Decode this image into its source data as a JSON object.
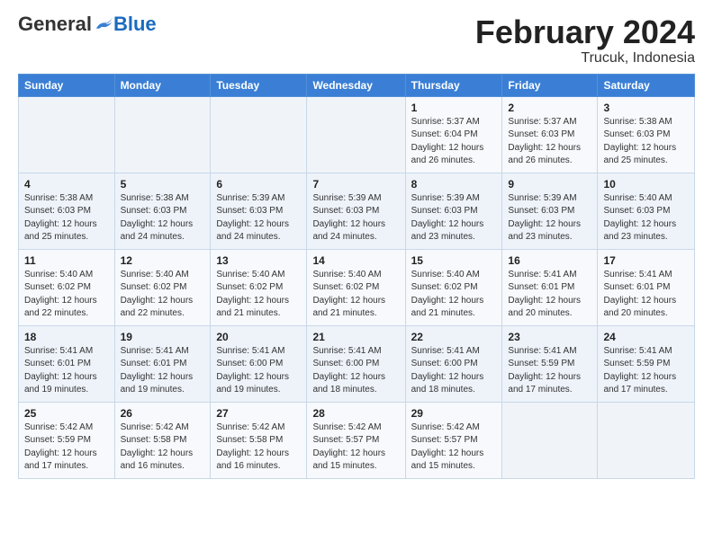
{
  "header": {
    "logo_general": "General",
    "logo_blue": "Blue",
    "month_title": "February 2024",
    "location": "Trucuk, Indonesia"
  },
  "weekdays": [
    "Sunday",
    "Monday",
    "Tuesday",
    "Wednesday",
    "Thursday",
    "Friday",
    "Saturday"
  ],
  "weeks": [
    [
      {
        "day": "",
        "info": ""
      },
      {
        "day": "",
        "info": ""
      },
      {
        "day": "",
        "info": ""
      },
      {
        "day": "",
        "info": ""
      },
      {
        "day": "1",
        "info": "Sunrise: 5:37 AM\nSunset: 6:04 PM\nDaylight: 12 hours\nand 26 minutes."
      },
      {
        "day": "2",
        "info": "Sunrise: 5:37 AM\nSunset: 6:03 PM\nDaylight: 12 hours\nand 26 minutes."
      },
      {
        "day": "3",
        "info": "Sunrise: 5:38 AM\nSunset: 6:03 PM\nDaylight: 12 hours\nand 25 minutes."
      }
    ],
    [
      {
        "day": "4",
        "info": "Sunrise: 5:38 AM\nSunset: 6:03 PM\nDaylight: 12 hours\nand 25 minutes."
      },
      {
        "day": "5",
        "info": "Sunrise: 5:38 AM\nSunset: 6:03 PM\nDaylight: 12 hours\nand 24 minutes."
      },
      {
        "day": "6",
        "info": "Sunrise: 5:39 AM\nSunset: 6:03 PM\nDaylight: 12 hours\nand 24 minutes."
      },
      {
        "day": "7",
        "info": "Sunrise: 5:39 AM\nSunset: 6:03 PM\nDaylight: 12 hours\nand 24 minutes."
      },
      {
        "day": "8",
        "info": "Sunrise: 5:39 AM\nSunset: 6:03 PM\nDaylight: 12 hours\nand 23 minutes."
      },
      {
        "day": "9",
        "info": "Sunrise: 5:39 AM\nSunset: 6:03 PM\nDaylight: 12 hours\nand 23 minutes."
      },
      {
        "day": "10",
        "info": "Sunrise: 5:40 AM\nSunset: 6:03 PM\nDaylight: 12 hours\nand 23 minutes."
      }
    ],
    [
      {
        "day": "11",
        "info": "Sunrise: 5:40 AM\nSunset: 6:02 PM\nDaylight: 12 hours\nand 22 minutes."
      },
      {
        "day": "12",
        "info": "Sunrise: 5:40 AM\nSunset: 6:02 PM\nDaylight: 12 hours\nand 22 minutes."
      },
      {
        "day": "13",
        "info": "Sunrise: 5:40 AM\nSunset: 6:02 PM\nDaylight: 12 hours\nand 21 minutes."
      },
      {
        "day": "14",
        "info": "Sunrise: 5:40 AM\nSunset: 6:02 PM\nDaylight: 12 hours\nand 21 minutes."
      },
      {
        "day": "15",
        "info": "Sunrise: 5:40 AM\nSunset: 6:02 PM\nDaylight: 12 hours\nand 21 minutes."
      },
      {
        "day": "16",
        "info": "Sunrise: 5:41 AM\nSunset: 6:01 PM\nDaylight: 12 hours\nand 20 minutes."
      },
      {
        "day": "17",
        "info": "Sunrise: 5:41 AM\nSunset: 6:01 PM\nDaylight: 12 hours\nand 20 minutes."
      }
    ],
    [
      {
        "day": "18",
        "info": "Sunrise: 5:41 AM\nSunset: 6:01 PM\nDaylight: 12 hours\nand 19 minutes."
      },
      {
        "day": "19",
        "info": "Sunrise: 5:41 AM\nSunset: 6:01 PM\nDaylight: 12 hours\nand 19 minutes."
      },
      {
        "day": "20",
        "info": "Sunrise: 5:41 AM\nSunset: 6:00 PM\nDaylight: 12 hours\nand 19 minutes."
      },
      {
        "day": "21",
        "info": "Sunrise: 5:41 AM\nSunset: 6:00 PM\nDaylight: 12 hours\nand 18 minutes."
      },
      {
        "day": "22",
        "info": "Sunrise: 5:41 AM\nSunset: 6:00 PM\nDaylight: 12 hours\nand 18 minutes."
      },
      {
        "day": "23",
        "info": "Sunrise: 5:41 AM\nSunset: 5:59 PM\nDaylight: 12 hours\nand 17 minutes."
      },
      {
        "day": "24",
        "info": "Sunrise: 5:41 AM\nSunset: 5:59 PM\nDaylight: 12 hours\nand 17 minutes."
      }
    ],
    [
      {
        "day": "25",
        "info": "Sunrise: 5:42 AM\nSunset: 5:59 PM\nDaylight: 12 hours\nand 17 minutes."
      },
      {
        "day": "26",
        "info": "Sunrise: 5:42 AM\nSunset: 5:58 PM\nDaylight: 12 hours\nand 16 minutes."
      },
      {
        "day": "27",
        "info": "Sunrise: 5:42 AM\nSunset: 5:58 PM\nDaylight: 12 hours\nand 16 minutes."
      },
      {
        "day": "28",
        "info": "Sunrise: 5:42 AM\nSunset: 5:57 PM\nDaylight: 12 hours\nand 15 minutes."
      },
      {
        "day": "29",
        "info": "Sunrise: 5:42 AM\nSunset: 5:57 PM\nDaylight: 12 hours\nand 15 minutes."
      },
      {
        "day": "",
        "info": ""
      },
      {
        "day": "",
        "info": ""
      }
    ]
  ]
}
